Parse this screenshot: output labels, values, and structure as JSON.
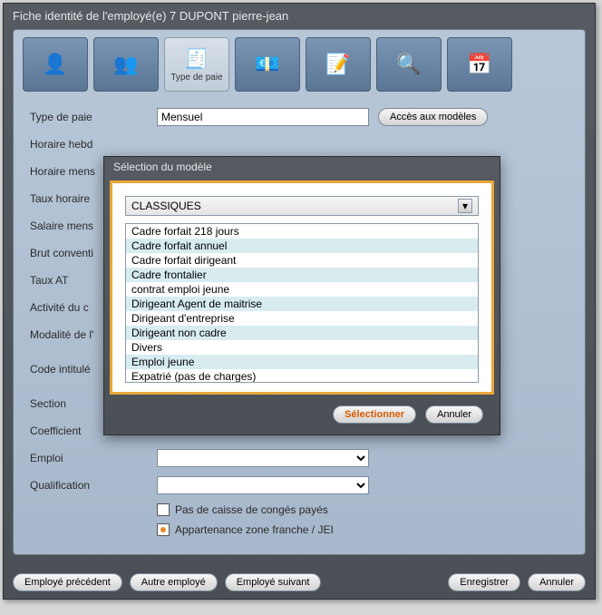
{
  "window": {
    "title": "Fiche identité de l'employé(e) 7 DUPONT pierre-jean"
  },
  "tabs": {
    "items": [
      {
        "icon": "👤",
        "label": ""
      },
      {
        "icon": "👥",
        "label": ""
      },
      {
        "icon": "🧾",
        "label": "Type de paie"
      },
      {
        "icon": "💶",
        "label": ""
      },
      {
        "icon": "📝",
        "label": ""
      },
      {
        "icon": "🔍",
        "label": ""
      },
      {
        "icon": "📅",
        "label": ""
      }
    ]
  },
  "form": {
    "type_paie_label": "Type de paie",
    "type_paie_value": "Mensuel",
    "acces_modeles": "Accès aux modèles",
    "horaire_hebdo_label": "Horaire hebd",
    "horaire_mensuel_label": "Horaire mens",
    "taux_horaire_label": "Taux horaire",
    "salaire_mensuel_label": "Salaire mens",
    "brut_conventionnel_label": "Brut conventi",
    "taux_at_label": "Taux AT",
    "activite_label": "Activité du c",
    "modalite_label": "Modalité de l'",
    "code_intitule_label": "Code intitulé",
    "section_label": "Section",
    "coefficient_label": "Coefficient",
    "emploi_label": "Emploi",
    "qualification_label": "Qualification",
    "cb_caisse": "Pas de caisse de congés payés",
    "cb_zone_franche": "Appartenance zone franche / JEI"
  },
  "footer": {
    "prev": "Employé précédent",
    "other": "Autre employé",
    "next": "Employé suivant",
    "save": "Enregistrer",
    "cancel": "Annuler"
  },
  "modal": {
    "title": "Sélection du modèle",
    "category": "CLASSIQUES",
    "items": [
      "Cadre forfait 218 jours",
      "Cadre forfait annuel",
      "Cadre forfait dirigeant",
      "Cadre frontalier",
      "contrat emploi jeune",
      "Dirigeant Agent de maitrise",
      "Dirigeant d'entreprise",
      "Dirigeant non cadre",
      "Divers",
      "Emploi jeune",
      "Expatrié (pas de charges)"
    ],
    "select_btn": "Sélectionner",
    "cancel_btn": "Annuler"
  }
}
